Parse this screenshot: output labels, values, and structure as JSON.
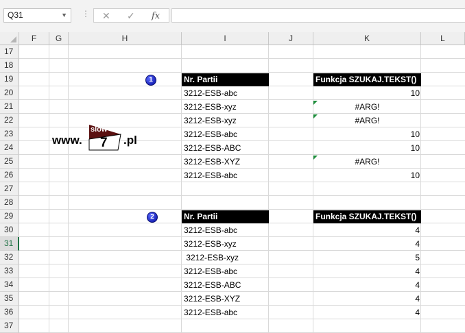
{
  "formula_bar": {
    "name_box": "Q31",
    "cancel_icon": "close-icon",
    "enter_icon": "check-icon",
    "fx_label": "fx",
    "formula": ""
  },
  "columns": [
    "F",
    "G",
    "H",
    "I",
    "J",
    "K",
    "L"
  ],
  "rows": [
    "17",
    "18",
    "19",
    "20",
    "21",
    "22",
    "23",
    "24",
    "25",
    "26",
    "27",
    "28",
    "29",
    "30",
    "31",
    "32",
    "33",
    "34",
    "35",
    "36",
    "37"
  ],
  "selected_row": "31",
  "accent_color": "#217346",
  "error_indicator_color": "#1e8f3c",
  "badges": {
    "one": "1",
    "two": "2"
  },
  "logo": {
    "prefix": "www.",
    "word": "slow",
    "digit": "7",
    "suffix": ".pl"
  },
  "table1": {
    "header_batch": "Nr. Partii",
    "header_func": "Funkcja SZUKAJ.TEKST()",
    "rows": [
      {
        "batch": "3212-ESB-abc",
        "result": "10"
      },
      {
        "batch": "3212-ESB-xyz",
        "result": "#ARG!"
      },
      {
        "batch": "3212-ESB-xyz",
        "result": "#ARG!"
      },
      {
        "batch": "3212-ESB-abc",
        "result": "10"
      },
      {
        "batch": "3212-ESB-ABC",
        "result": "10"
      },
      {
        "batch": "3212-ESB-XYZ",
        "result": "#ARG!"
      },
      {
        "batch": "3212-ESB-abc",
        "result": "10"
      }
    ]
  },
  "table2": {
    "header_batch": "Nr. Partii",
    "header_func": "Funkcja SZUKAJ.TEKST()",
    "rows": [
      {
        "batch": "3212-ESB-abc",
        "result": "4"
      },
      {
        "batch": "3212-ESB-xyz",
        "result": "4"
      },
      {
        "batch": " 3212-ESB-xyz",
        "result": "5"
      },
      {
        "batch": "3212-ESB-abc",
        "result": "4"
      },
      {
        "batch": "3212-ESB-ABC",
        "result": "4"
      },
      {
        "batch": "3212-ESB-XYZ",
        "result": "4"
      },
      {
        "batch": "3212-ESB-abc",
        "result": "4"
      }
    ]
  }
}
